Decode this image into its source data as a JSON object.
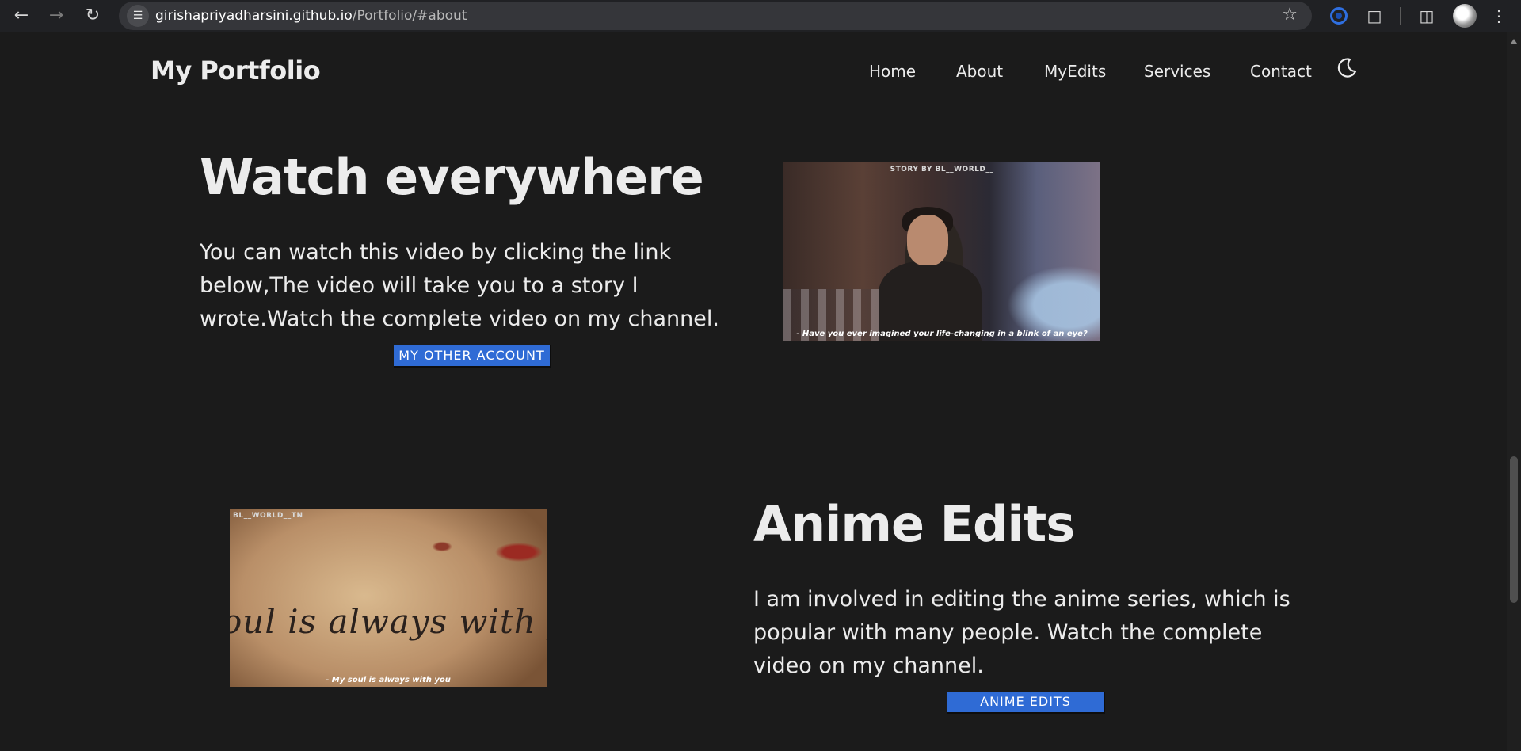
{
  "browser": {
    "url_host": "girishapriyadharsini.github.io",
    "url_path": "/Portfolio/#about"
  },
  "site": {
    "brand": "My Portfolio",
    "nav": [
      "Home",
      "About",
      "MyEdits",
      "Services",
      "Contact"
    ]
  },
  "sections": [
    {
      "heading": "Watch everywhere",
      "text": "You can watch this video by clicking the link below,The video will take you to a story I wrote.Watch the complete video on my channel.",
      "button": "MY OTHER ACCOUNT",
      "thumb_top": "STORY BY BL__WORLD__",
      "thumb_caption": "- Have you ever imagined your life-changing in a blink of an eye?"
    },
    {
      "heading": "Anime Edits",
      "text": "I am involved in editing the anime series, which is popular with many people. Watch the complete video on my channel.",
      "button": "ANIME EDITS",
      "thumb_top": "BL__WORLD__TN",
      "thumb_script": "oul is always with you",
      "thumb_caption": "- My soul is always with you"
    }
  ],
  "colors": {
    "page_bg": "#1b1b1b",
    "text": "#ececec",
    "button_bg": "#2f6bd5"
  }
}
